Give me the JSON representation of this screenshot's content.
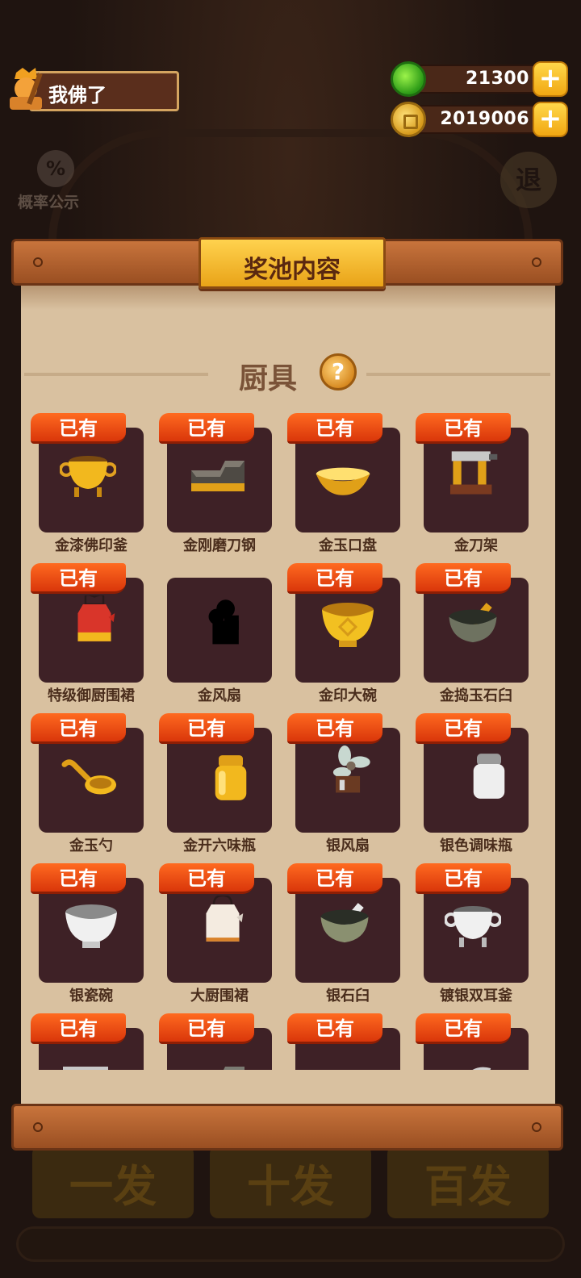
{
  "player": {
    "name": "我佛了"
  },
  "currencies": {
    "jade": {
      "value": "21300"
    },
    "coins": {
      "value": "2019006"
    }
  },
  "top_buttons": {
    "probability_label": "概率公示",
    "probability_symbol": "%",
    "exit_label": "退"
  },
  "panel": {
    "title": "奖池内容"
  },
  "section": {
    "title": "厨具",
    "help_symbol": "?"
  },
  "owned_label": "已有",
  "items": [
    {
      "name": "金漆佛印釜",
      "owned": true,
      "icon": "gold-cauldron-icon"
    },
    {
      "name": "金刚磨刀钢",
      "owned": true,
      "icon": "gold-whetstone-icon"
    },
    {
      "name": "金玉口盘",
      "owned": true,
      "icon": "gold-plate-icon"
    },
    {
      "name": "金刀架",
      "owned": true,
      "icon": "gold-knife-rack-icon"
    },
    {
      "name": "特级御厨围裙",
      "owned": true,
      "icon": "red-apron-icon"
    },
    {
      "name": "金风扇",
      "owned": false,
      "icon": "locked-fan-silhouette-icon"
    },
    {
      "name": "金印大碗",
      "owned": true,
      "icon": "gold-bowl-icon"
    },
    {
      "name": "金捣玉石臼",
      "owned": true,
      "icon": "stone-mortar-icon"
    },
    {
      "name": "金玉勺",
      "owned": true,
      "icon": "gold-ladle-icon"
    },
    {
      "name": "金开六味瓶",
      "owned": true,
      "icon": "gold-shaker-icon"
    },
    {
      "name": "银风扇",
      "owned": true,
      "icon": "silver-fan-icon"
    },
    {
      "name": "银色调味瓶",
      "owned": true,
      "icon": "silver-shaker-icon"
    },
    {
      "name": "银瓷碗",
      "owned": true,
      "icon": "silver-bowl-icon"
    },
    {
      "name": "大厨围裙",
      "owned": true,
      "icon": "white-apron-icon"
    },
    {
      "name": "银石臼",
      "owned": true,
      "icon": "silver-mortar-icon"
    },
    {
      "name": "镀银双耳釜",
      "owned": true,
      "icon": "silver-cauldron-icon"
    },
    {
      "name": "",
      "owned": true,
      "icon": "partial-item-icon"
    },
    {
      "name": "",
      "owned": true,
      "icon": "partial-item-icon"
    },
    {
      "name": "",
      "owned": true,
      "icon": "partial-item-icon"
    },
    {
      "name": "",
      "owned": true,
      "icon": "partial-item-icon"
    }
  ],
  "background_buttons": [
    "一发",
    "十发",
    "百发"
  ],
  "colors": {
    "owned_tag": "#e8471a",
    "item_box": "#3e2126",
    "paper": "#d9c1a0",
    "title_plate": "#f3bb2c"
  }
}
